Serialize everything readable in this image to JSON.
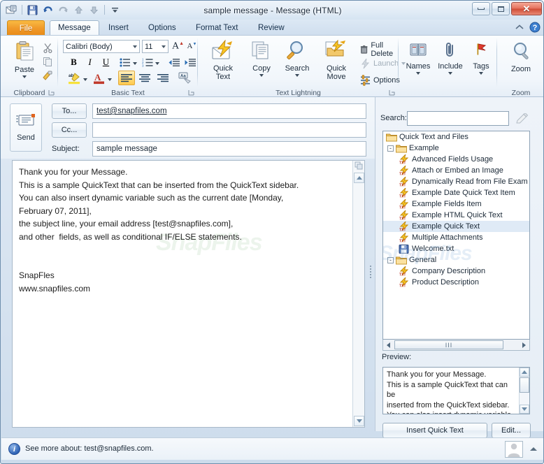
{
  "window": {
    "title": "sample message  -  Message (HTML)",
    "controls": {
      "minimize": "Minimize",
      "maximize": "Maximize",
      "close": "✕"
    }
  },
  "quick_access_toolbar": {
    "items": [
      {
        "name": "outlook-logo-icon",
        "label": "Outlook"
      },
      {
        "name": "save-icon",
        "label": "Save"
      },
      {
        "name": "undo-icon",
        "label": "Undo"
      },
      {
        "name": "redo-icon",
        "label": "Redo"
      },
      {
        "name": "previous-item-icon",
        "label": "Previous Item"
      },
      {
        "name": "next-item-icon",
        "label": "Next Item"
      },
      {
        "name": "customize-qat-icon",
        "label": "Customize Quick Access Toolbar"
      }
    ]
  },
  "tabs": [
    {
      "label": "File",
      "active": false,
      "file": true
    },
    {
      "label": "Message",
      "active": true
    },
    {
      "label": "Insert",
      "active": false
    },
    {
      "label": "Options",
      "active": false
    },
    {
      "label": "Format Text",
      "active": false
    },
    {
      "label": "Review",
      "active": false
    }
  ],
  "ribbon": {
    "collapse_label": "Minimize the Ribbon",
    "help_label": "?",
    "groups": [
      {
        "title": "Clipboard"
      },
      {
        "title": "Basic Text"
      },
      {
        "title": "Text Lightning"
      },
      {
        "title": "Zoom"
      }
    ],
    "clipboard": {
      "paste_label": "Paste",
      "cut_label": "Cut",
      "copy_label": "Copy",
      "format_painter_label": "Format Painter"
    },
    "basic_text": {
      "font_name": "Calibri (Body)",
      "font_size": "11",
      "grow_font": "A",
      "shrink_font": "A",
      "bold": "B",
      "italic": "I",
      "underline": "U",
      "bullets": "Bullets",
      "numbering": "Numbering",
      "decrease_indent": "Decrease Indent",
      "increase_indent": "Increase Indent",
      "highlight": "ab",
      "font_color": "A",
      "align_left": "Align Text Left",
      "align_center": "Center",
      "align_right": "Align Text Right",
      "clear_formatting": "Aa"
    },
    "text_lightning": {
      "quick_text": "Quick\nText",
      "quick_text_line1": "Quick",
      "quick_text_line2": "Text",
      "copy_line1": "Copy",
      "search_line1": "Search",
      "quick_move_line1": "Quick",
      "quick_move_line2": "Move",
      "full_delete": "Full Delete",
      "launch": "Launch",
      "options": "Options"
    },
    "names_group": {
      "names": "Names",
      "include": "Include",
      "tags": "Tags"
    },
    "zoom_group": {
      "zoom": "Zoom"
    }
  },
  "compose": {
    "send_label": "Send",
    "to_button": "To...",
    "cc_button": "Cc...",
    "subject_label": "Subject:",
    "to_value": "test@snapfiles.com",
    "cc_value": "",
    "subject_value": "sample message",
    "body": "Thank you for your Message.\nThis is a sample QuickText that can be inserted from the QuickText sidebar.\nYou can also insert dynamic variable such as the current date [Monday,\nFebruary 07, 2011],\nthe subject line, your email address [test@snapfiles.com],\nand other  fields, as well as conditional IF/ELSE statements.\n\n\nSnapFles\nwww.snapfiles.com"
  },
  "sidebar": {
    "search_label": "Search:",
    "search_value": "",
    "search_placeholder": "",
    "pencil_button": "Edit search",
    "tree": [
      {
        "label": "Quick Text and Files",
        "type": "folder",
        "depth": 0,
        "expander": "",
        "selected": false
      },
      {
        "label": "Example",
        "type": "folder",
        "depth": 1,
        "expander": "-",
        "selected": false
      },
      {
        "label": "Advanced Fields Usage",
        "type": "quicktext",
        "depth": 2,
        "expander": "",
        "selected": false
      },
      {
        "label": "Attach or Embed an Image",
        "type": "quicktext",
        "depth": 2,
        "expander": "",
        "selected": false
      },
      {
        "label": "Dynamically Read from File Exam",
        "type": "quicktext",
        "depth": 2,
        "expander": "",
        "selected": false
      },
      {
        "label": "Example Date Quick Text Item",
        "type": "quicktext",
        "depth": 2,
        "expander": "",
        "selected": false
      },
      {
        "label": "Example Fields Item",
        "type": "quicktext",
        "depth": 2,
        "expander": "",
        "selected": false
      },
      {
        "label": "Example HTML Quick Text",
        "type": "quicktext",
        "depth": 2,
        "expander": "",
        "selected": false
      },
      {
        "label": "Example Quick Text",
        "type": "quicktext",
        "depth": 2,
        "expander": "",
        "selected": true
      },
      {
        "label": "Multiple Attachments",
        "type": "quicktext",
        "depth": 2,
        "expander": "",
        "selected": false
      },
      {
        "label": "Welcome.txt",
        "type": "file",
        "depth": 2,
        "expander": "",
        "selected": false
      },
      {
        "label": "General",
        "type": "folder",
        "depth": 1,
        "expander": "-",
        "selected": false
      },
      {
        "label": "Company Description",
        "type": "quicktext",
        "depth": 2,
        "expander": "",
        "selected": false
      },
      {
        "label": "Product Description",
        "type": "quicktext",
        "depth": 2,
        "expander": "",
        "selected": false
      }
    ],
    "hscroll_grip": "III",
    "preview_label": "Preview:",
    "preview_text": "Thank you for your Message.\nThis is a sample QuickText that can be\ninserted from the QuickText sidebar.\nYou can also insert dynamic variable",
    "insert_button": "Insert Quick Text",
    "edit_button": "Edit..."
  },
  "statusbar": {
    "text": "See more about: test@snapfiles.com.",
    "info_icon": "i",
    "contact_card": "Contact photo"
  },
  "watermark": {
    "text": "SnapFiles"
  },
  "colors": {
    "file_tab": "#ef9a20",
    "accent_blue": "#2f63b5",
    "selection": "#dfeaf6",
    "window_border": "#6f8fae",
    "close_red": "#cf4b36",
    "folder_yellow": "#f0c04a",
    "bolt_yellow": "#fbc02d"
  }
}
